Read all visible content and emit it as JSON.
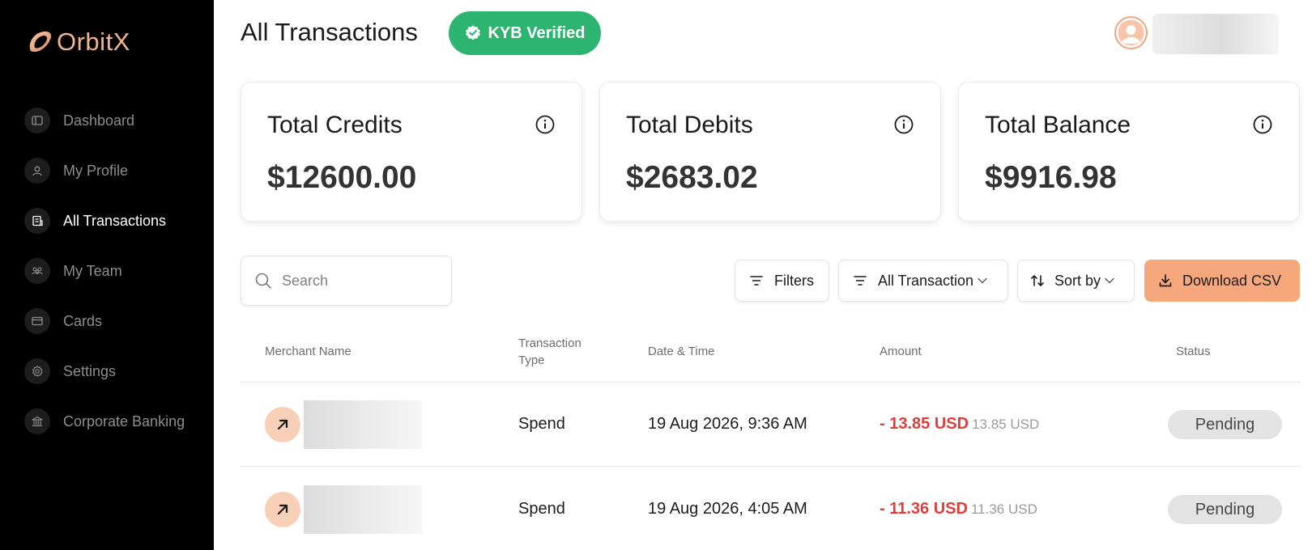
{
  "brand": {
    "name": "OrbitX",
    "color": "#f0b48e"
  },
  "sidebar": {
    "items": [
      {
        "label": "Dashboard",
        "icon": "dashboard-icon",
        "active": false
      },
      {
        "label": "My Profile",
        "icon": "user-icon",
        "active": false
      },
      {
        "label": "All Transactions",
        "icon": "receipt-icon",
        "active": true
      },
      {
        "label": "My Team",
        "icon": "team-icon",
        "active": false
      },
      {
        "label": "Cards",
        "icon": "card-icon",
        "active": false
      },
      {
        "label": "Settings",
        "icon": "gear-icon",
        "active": false
      },
      {
        "label": "Corporate Banking",
        "icon": "bank-icon",
        "active": false
      }
    ]
  },
  "header": {
    "title": "All Transactions",
    "kyb_badge": "KYB Verified",
    "kyb_color": "#2db56f"
  },
  "summary": [
    {
      "label": "Total Credits",
      "value": "$12600.00"
    },
    {
      "label": "Total Debits",
      "value": "$2683.02"
    },
    {
      "label": "Total Balance",
      "value": "$9916.98"
    }
  ],
  "toolbar": {
    "search_placeholder": "Search",
    "filters_label": "Filters",
    "all_transaction_label": "All Transaction",
    "sort_label": "Sort by",
    "download_label": "Download CSV",
    "download_color": "#f7a77c"
  },
  "table": {
    "columns": {
      "merchant": "Merchant Name",
      "type_line1": "Transaction",
      "type_line2": "Type",
      "datetime": "Date & Time",
      "amount": "Amount",
      "status": "Status"
    },
    "rows": [
      {
        "type": "Spend",
        "datetime": "19 Aug 2026, 9:36 AM",
        "amount": "- 13.85 USD",
        "amount_sub": "13.85 USD",
        "status": "Pending"
      },
      {
        "type": "Spend",
        "datetime": "19 Aug 2026, 4:05 AM",
        "amount": "- 11.36 USD",
        "amount_sub": "11.36 USD",
        "status": "Pending"
      }
    ]
  },
  "colors": {
    "negative_amount": "#e03d3d",
    "status_pending_bg": "#e3e3e3"
  }
}
